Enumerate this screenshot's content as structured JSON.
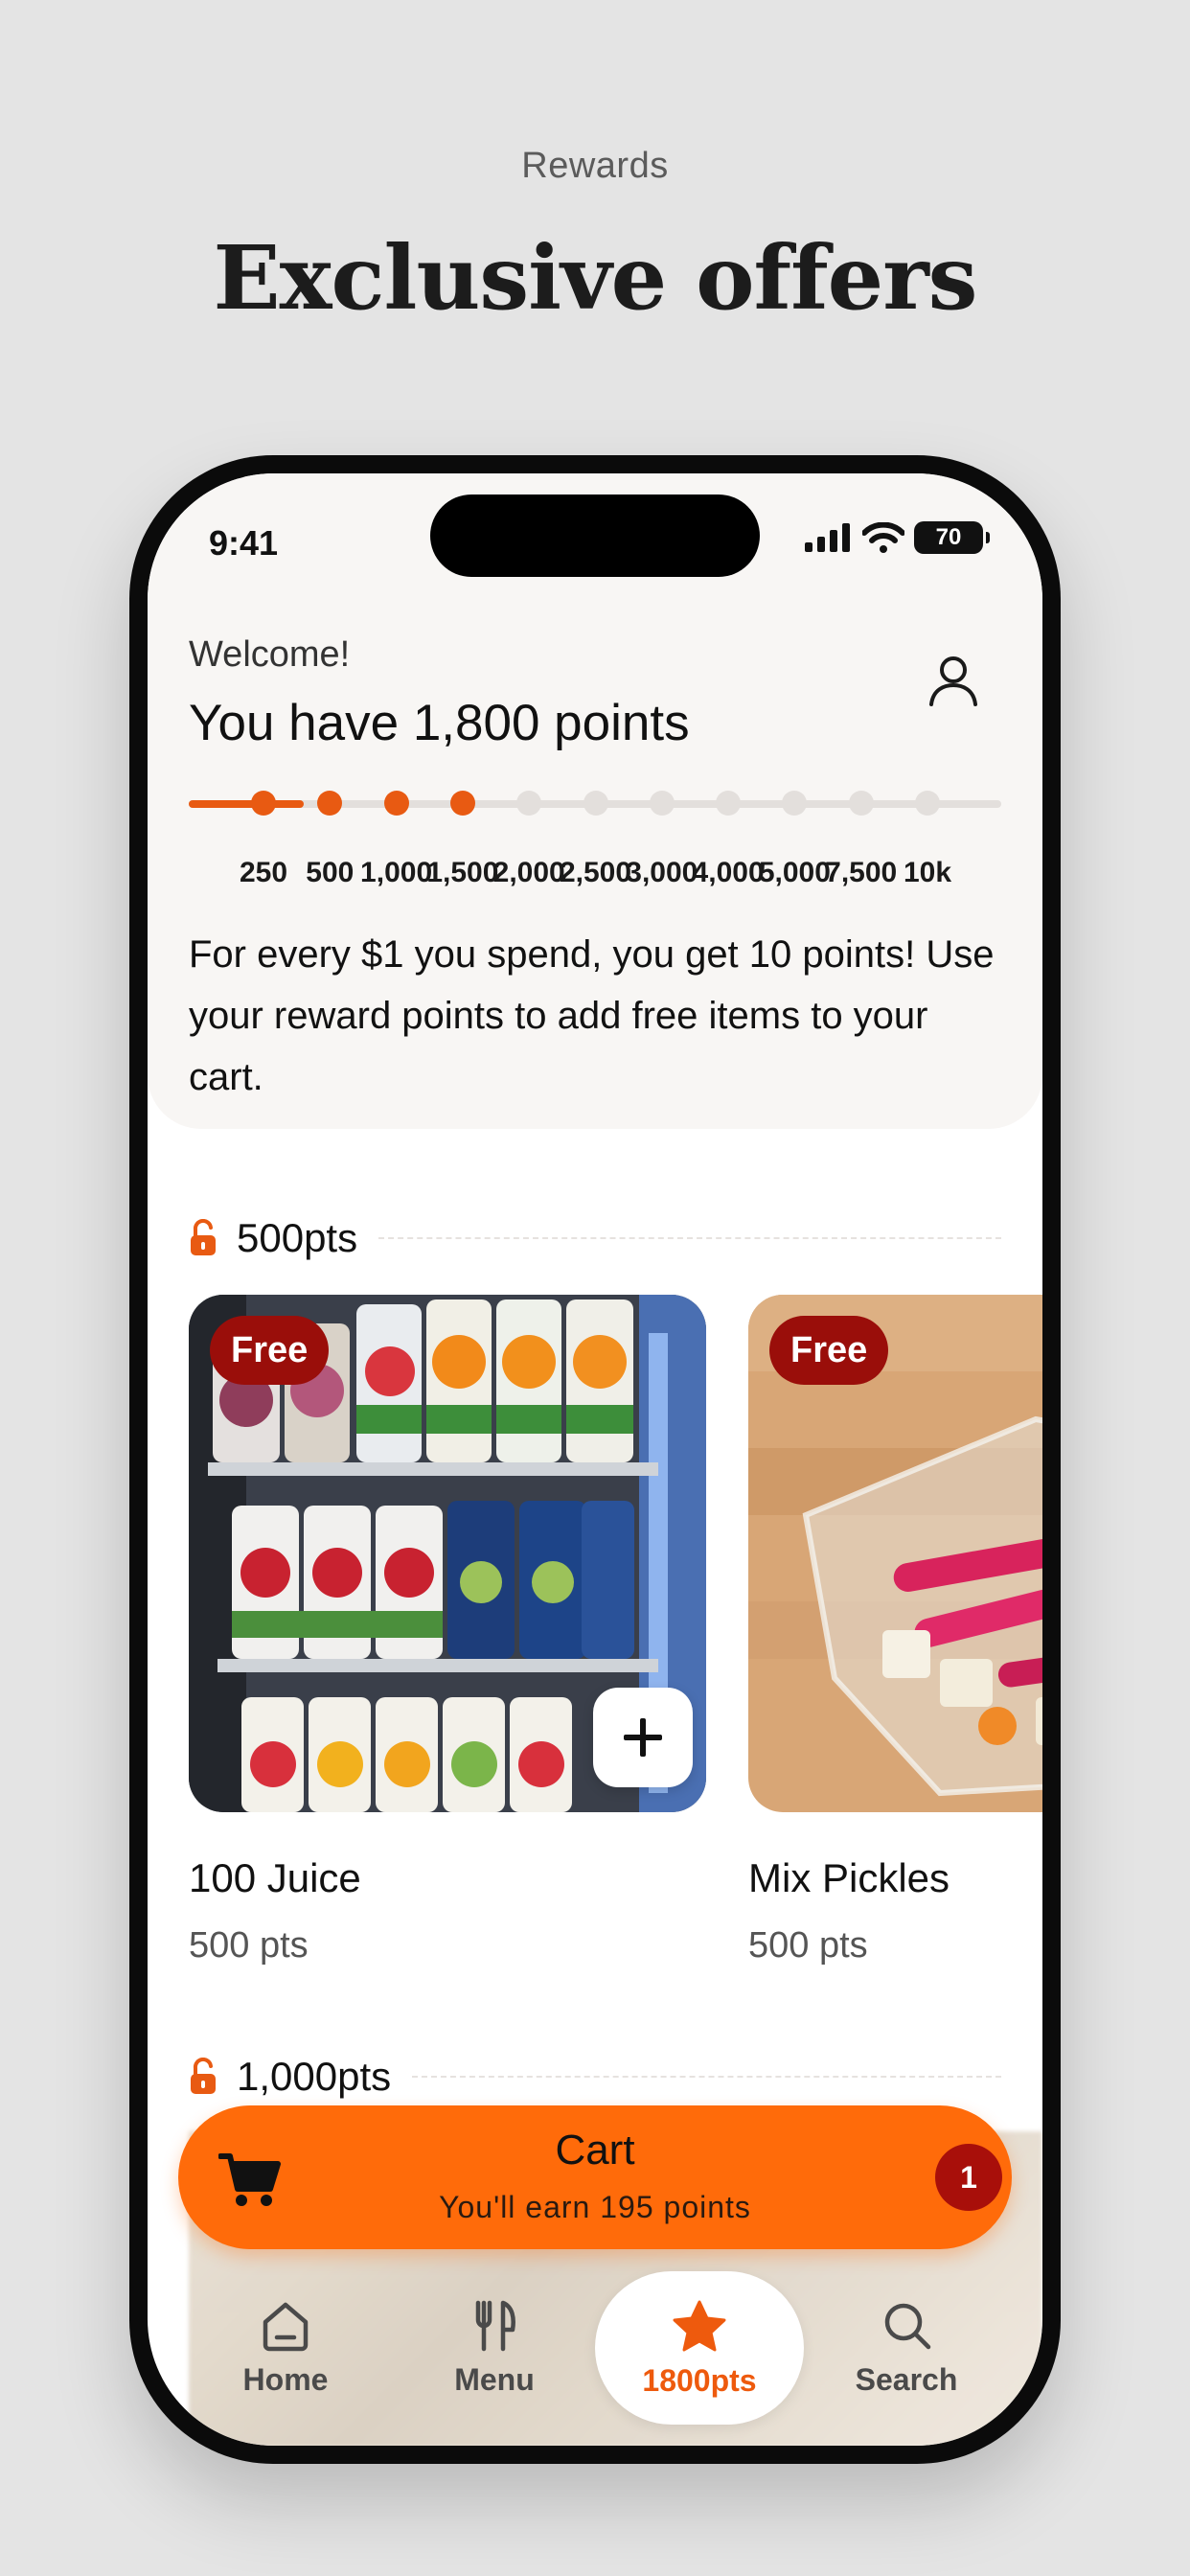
{
  "promo": {
    "kicker": "Rewards",
    "title": "Exclusive offers"
  },
  "status_bar": {
    "time": "9:41",
    "battery": "70"
  },
  "header": {
    "welcome": "Welcome!",
    "points_title": "You have 1,800 points",
    "info": "For every $1 you spend, you get 10 points! Use your reward points to add free items to your cart."
  },
  "progress": {
    "current_points": 1800,
    "ticks": [
      "250",
      "500",
      "1,000",
      "1,500",
      "2,000",
      "2,500",
      "3,000",
      "4,000",
      "5,000",
      "7,500",
      "10k"
    ]
  },
  "sections": [
    {
      "label": "500pts"
    },
    {
      "label": "1,000pts"
    }
  ],
  "cards": [
    {
      "badge": "Free",
      "name": "100 Juice",
      "points": "500 pts"
    },
    {
      "badge": "Free",
      "name": "Mix Pickles",
      "points": "500 pts"
    }
  ],
  "cart": {
    "title": "Cart",
    "subtitle": "You'll earn 195 points",
    "count": "1"
  },
  "tabs": [
    {
      "label": "Home",
      "icon": "home-icon"
    },
    {
      "label": "Menu",
      "icon": "utensils-icon"
    },
    {
      "label": "1800pts",
      "icon": "star-icon"
    },
    {
      "label": "Search",
      "icon": "search-icon"
    }
  ],
  "colors": {
    "accent": "#ff6b0a",
    "progress": "#e85a12",
    "badge": "#9a0e0a",
    "active_tab": "#ee5a0d"
  }
}
